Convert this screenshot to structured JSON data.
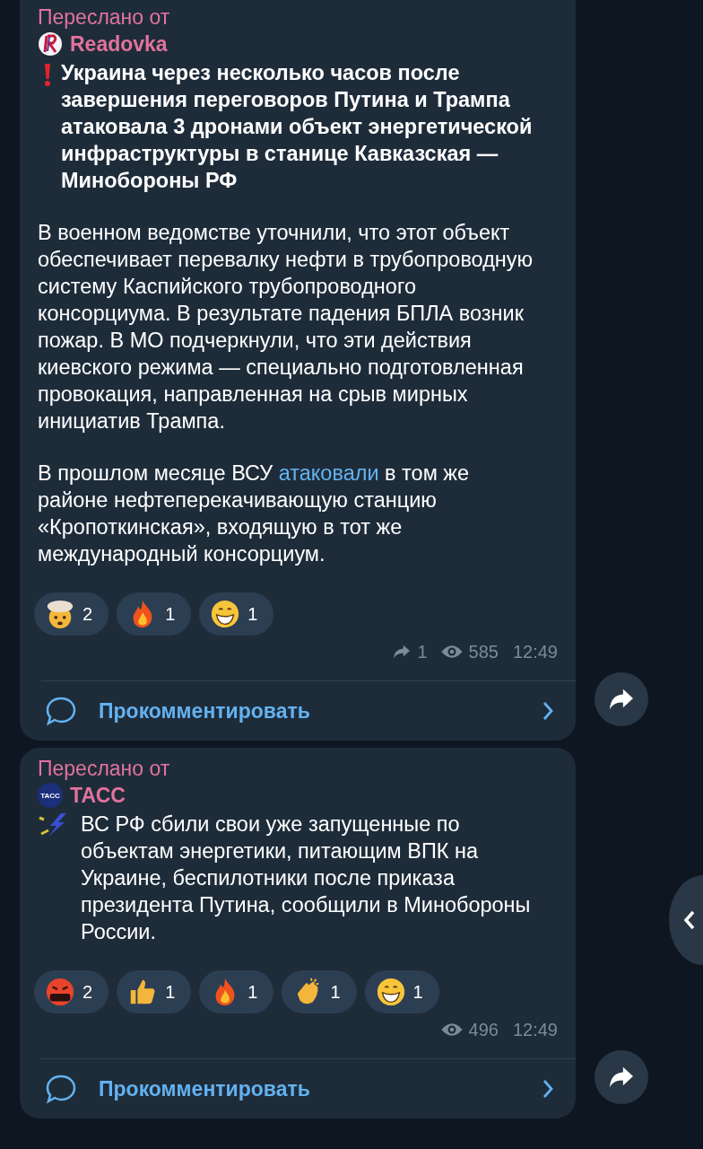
{
  "posts": [
    {
      "forwarded_label": "Переслано от",
      "source": {
        "name": "Readovka",
        "kind": "readovka"
      },
      "lead": {
        "kind": "exclamation"
      },
      "blocks": [
        {
          "kind": "headline",
          "parts": [
            {
              "kind": "text",
              "text": "Украина через несколько часов после завершения переговоров Путина и Трампа атаковала 3 дронами объект энергетической инфраструктуры в станице Кавказская — Минобороны РФ"
            }
          ]
        },
        {
          "kind": "text",
          "parts": [
            {
              "kind": "text",
              "text": "В военном ведомстве уточнили, что этот объект обеспечивает перевалку нефти в трубопроводную систему Каспийского трубопроводного консорциума. В результате падения БПЛА возник пожар. В МО подчеркнули, что эти действия киевского режима — специально подготовленная провокация, направленная на срыв мирных инициатив Трампа."
            }
          ]
        },
        {
          "kind": "text",
          "parts": [
            {
              "kind": "text",
              "text": "В прошлом месяце ВСУ "
            },
            {
              "kind": "link",
              "text": "атаковали"
            },
            {
              "kind": "text",
              "text": " в том же районе нефтеперекачивающую станцию «Кропоткинская», входящую в тот же международный консорциум."
            }
          ]
        }
      ],
      "reactions": [
        {
          "kind": "exploding",
          "count": "2"
        },
        {
          "kind": "fire",
          "count": "1"
        },
        {
          "kind": "grin",
          "count": "1"
        }
      ],
      "meta": {
        "shares": "1",
        "views": "585",
        "time": "12:49"
      },
      "comment_label": "Прокомментировать"
    },
    {
      "forwarded_label": "Переслано от",
      "source": {
        "name": "ТАСС",
        "kind": "tass",
        "avatar_text": "ТАСС"
      },
      "lead": {
        "kind": "lightning"
      },
      "blocks": [
        {
          "kind": "text",
          "parts": [
            {
              "kind": "text",
              "text": "ВС РФ сбили свои уже запущенные по объектам энергетики, питающим ВПК на Украине, беспилотники после приказа президента Путина, сообщили в Минобороны России."
            }
          ]
        }
      ],
      "reactions": [
        {
          "kind": "swearing",
          "count": "2"
        },
        {
          "kind": "thumbs",
          "count": "1"
        },
        {
          "kind": "fire",
          "count": "1"
        },
        {
          "kind": "clap",
          "count": "1"
        },
        {
          "kind": "grin",
          "count": "1"
        }
      ],
      "meta": {
        "views": "496",
        "time": "12:49"
      },
      "comment_label": "Прокомментировать"
    }
  ]
}
